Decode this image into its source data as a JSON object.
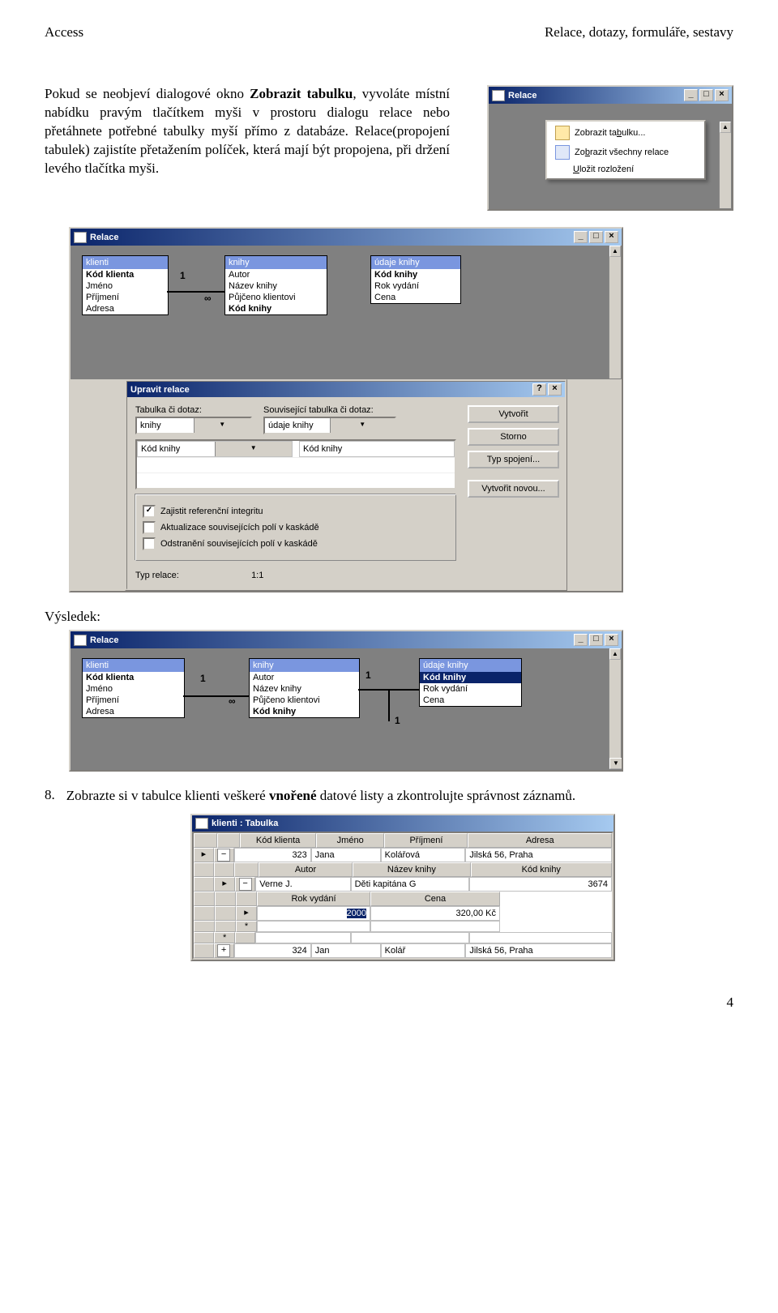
{
  "header": {
    "left": "Access",
    "right": "Relace, dotazy, formuláře, sestavy"
  },
  "body": {
    "p1a": "Pokud se neobjeví dialogové okno ",
    "p1b": "Zobrazit tabulku",
    "p1c": ", vyvoláte místní nabídku pravým tlačítkem myši v prostoru dialogu relace nebo přetáhnete potřebné tabulky myší přímo z databáze. Relace(propojení tabulek) zajistíte přetažením políček, která mají být propojena, při držení levého tlačítka myši.",
    "result_label": "Výsledek:",
    "item8_num": "8.",
    "item8a": "Zobrazte si v tabulce klienti veškeré ",
    "item8b": "vnořené",
    "item8c": " datové listy a zkontrolujte správnost záznamů.",
    "pagenum": "4"
  },
  "ctxwin": {
    "title": "Relace",
    "menu": [
      {
        "label_pre": "Zobrazit ta",
        "label_u": "b",
        "label_post": "ulku..."
      },
      {
        "label_pre": "Zo",
        "label_u": "b",
        "label_post": "razit všechny relace"
      },
      {
        "label_pre": "",
        "label_u": "U",
        "label_post": "ložit rozložení"
      }
    ],
    "btn_min": "_",
    "btn_max": "□",
    "btn_close": "×"
  },
  "relwin": {
    "title": "Relace",
    "tables": {
      "klienti": {
        "hdr": "klienti",
        "fields": [
          "Kód klienta",
          "Jméno",
          "Příjmení",
          "Adresa"
        ],
        "bold_idx": 0
      },
      "knihy": {
        "hdr": "knihy",
        "fields": [
          "Autor",
          "Název knihy",
          "Půjčeno klientovi",
          "Kód knihy"
        ],
        "bold_idx": 3
      },
      "udaje": {
        "hdr": "údaje knihy",
        "fields": [
          "Kód knihy",
          "Rok vydání",
          "Cena"
        ],
        "bold_idx": 0
      }
    },
    "label_1": "1",
    "label_inf": "∞"
  },
  "dlg": {
    "title": "Upravit relace",
    "help": "?",
    "close": "×",
    "lbl_left": "Tabulka či dotaz:",
    "lbl_right": "Související tabulka či dotaz:",
    "val_left": "knihy",
    "val_right": "údaje knihy",
    "fld_left": "Kód knihy",
    "fld_right": "Kód knihy",
    "chk1": "Zajistit referenční integritu",
    "chk2": "Aktualizace souvisejících polí v kaskádě",
    "chk3": "Odstranění souvisejících polí v kaskádě",
    "lbl_type": "Typ relace:",
    "val_type": "1:1",
    "btns": [
      "Vytvořit",
      "Storno",
      "Typ spojení...",
      "Vytvořit novou..."
    ]
  },
  "relwin2": {
    "title": "Relace",
    "sel_field": "Kód knihy",
    "label_1a": "1",
    "label_1b": "1",
    "label_1c": "1",
    "label_inf": "∞"
  },
  "dswin": {
    "title": "klienti : Tabulka",
    "cols": [
      "Kód klienta",
      "Jméno",
      "Příjmení",
      "Adresa"
    ],
    "row1": [
      "323",
      "Jana",
      "Kolářová",
      "Jilská 56, Praha"
    ],
    "sub1cols": [
      "Autor",
      "Název knihy",
      "Kód knihy"
    ],
    "sub1row": [
      "Verne J.",
      "Děti kapitána G",
      "3674"
    ],
    "sub2cols": [
      "Rok vydání",
      "Cena"
    ],
    "sub2row": [
      "2000",
      "320,00 Kč"
    ],
    "row2": [
      "324",
      "Jan",
      "Kolář",
      "Jilská 56, Praha"
    ],
    "plus": "+",
    "minus": "−",
    "star": "*",
    "arrow": "▸"
  }
}
